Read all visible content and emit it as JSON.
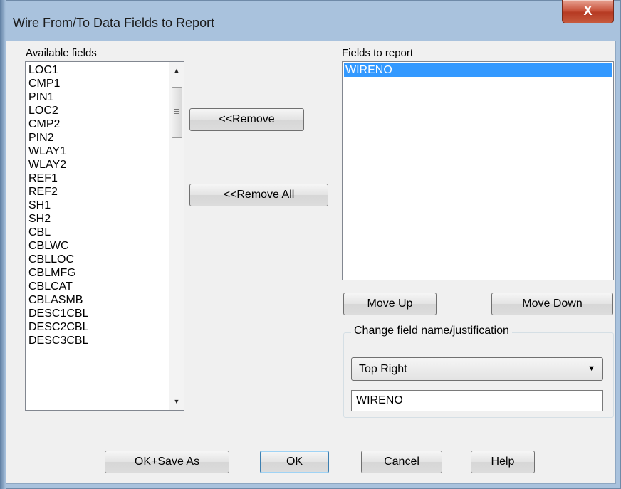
{
  "window": {
    "title": "Wire From/To Data Fields to Report",
    "close_glyph": "X"
  },
  "available": {
    "label": "Available fields",
    "items": [
      "LOC1",
      "CMP1",
      "PIN1",
      "LOC2",
      "CMP2",
      "PIN2",
      "WLAY1",
      "WLAY2",
      "REF1",
      "REF2",
      "SH1",
      "SH2",
      "CBL",
      "CBLWC",
      "CBLLOC",
      "CBLMFG",
      "CBLCAT",
      "CBLASMB",
      "DESC1CBL",
      "DESC2CBL",
      "DESC3CBL"
    ],
    "scroll_up": "▲",
    "scroll_down": "▼"
  },
  "report": {
    "label": "Fields to report",
    "items": [
      "WIRENO"
    ],
    "selected_index": 0
  },
  "buttons": {
    "remove": "<<Remove",
    "remove_all": "<<Remove All",
    "move_up": "Move Up",
    "move_down": "Move Down",
    "ok_save_as": "OK+Save As",
    "ok": "OK",
    "cancel": "Cancel",
    "help": "Help"
  },
  "change_group": {
    "title": "Change field name/justification",
    "justification": "Top Right",
    "dropdown_glyph": "▼",
    "field_name": "WIRENO"
  },
  "colors": {
    "selection": "#3399ff",
    "frame": "#a9c2dd",
    "close": "#c9553e"
  }
}
